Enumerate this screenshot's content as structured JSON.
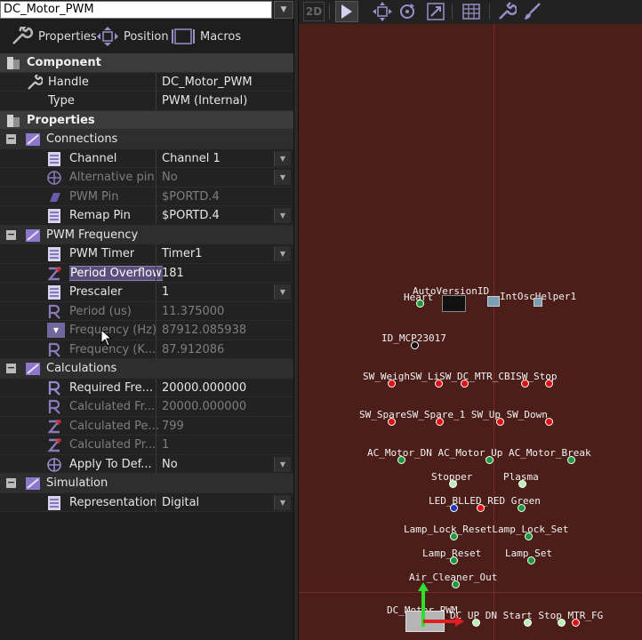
{
  "combo": {
    "value": "DC_Motor_PWM"
  },
  "tabs": [
    {
      "label": "Properties",
      "icon": "wrench-icon"
    },
    {
      "label": "Position",
      "icon": "move-icon"
    },
    {
      "label": "Macros",
      "icon": "macro-icon"
    }
  ],
  "props": {
    "component_header": "Component",
    "handle_label": "Handle",
    "handle_value": "DC_Motor_PWM",
    "type_label": "Type",
    "type_value": "PWM (Internal)",
    "properties_header": "Properties",
    "connections_label": "Connections",
    "channel_label": "Channel",
    "channel_value": "Channel 1",
    "altpin_label": "Alternative pin",
    "altpin_value": "No",
    "pwmpin_label": "PWM Pin",
    "pwmpin_value": "$PORTD.4",
    "remap_label": "Remap Pin",
    "remap_value": "$PORTD.4",
    "pwmfreq_label": "PWM Frequency",
    "timer_label": "PWM Timer",
    "timer_value": "Timer1",
    "overflow_label": "Period Overflow",
    "overflow_value": "181",
    "prescaler_label": "Prescaler",
    "prescaler_value": "1",
    "periodus_label": "Period (us)",
    "periodus_value": "11.375000",
    "freqhz_label": "Frequency (Hz)",
    "freqhz_value": "87912.085938",
    "freqk_label": "Frequency (K...",
    "freqk_value": "87.912086",
    "calc_label": "Calculations",
    "reqfreq_label": "Required Fre...",
    "reqfreq_value": "20000.000000",
    "calcfr_label": "Calculated Fr...",
    "calcfr_value": "20000.000000",
    "calcpe_label": "Calculated Pe...",
    "calcpe_value": "799",
    "calcpr_label": "Calculated Pr...",
    "calcpr_value": "1",
    "apply_label": "Apply To Def...",
    "apply_value": "No",
    "sim_label": "Simulation",
    "repr_label": "Representation",
    "repr_value": "Digital"
  },
  "toolbar": {
    "view_2d": "2D",
    "icons": [
      "select-icon",
      "pan-icon",
      "rotate-icon",
      "zoom-fit-icon",
      "grid-icon",
      "wrench-icon",
      "brush-icon"
    ]
  },
  "canvas": {
    "labels": {
      "heart": "Heart",
      "autoversion": "AutoVersionID",
      "intosc": "IntOscHelper1",
      "idmcp": "ID_MCP23017",
      "sw_row1": "SW_WeighSW_LiSW_DC_MTR_CBISW_Stop",
      "sw_row2": "SW_SpareSW_Spare_1  SW_Up  SW_Down",
      "ac_row": "AC_Motor_DN   AC_Motor_Up AC_Motor_Break",
      "stopper": "Stopper",
      "plasma": "Plasma",
      "led_row": "LED_BLLED_RED Green",
      "lamp_lock": "Lamp_Lock_ResetLamp_Lock_Set",
      "lamp_reset": "Lamp_Reset",
      "lamp_set": "Lamp_Set",
      "air_cleaner": "Air_Cleaner_Out",
      "dc_motor": "DC_Motor_PWM",
      "dc_bottom": "DC UP DN Start  Stop  MTR_FG"
    }
  },
  "colors": {
    "panel_bg": "#4b1e1a",
    "accent": "#8d82b8",
    "pin_red": "#e01010",
    "pin_green": "#1a9a3a"
  }
}
